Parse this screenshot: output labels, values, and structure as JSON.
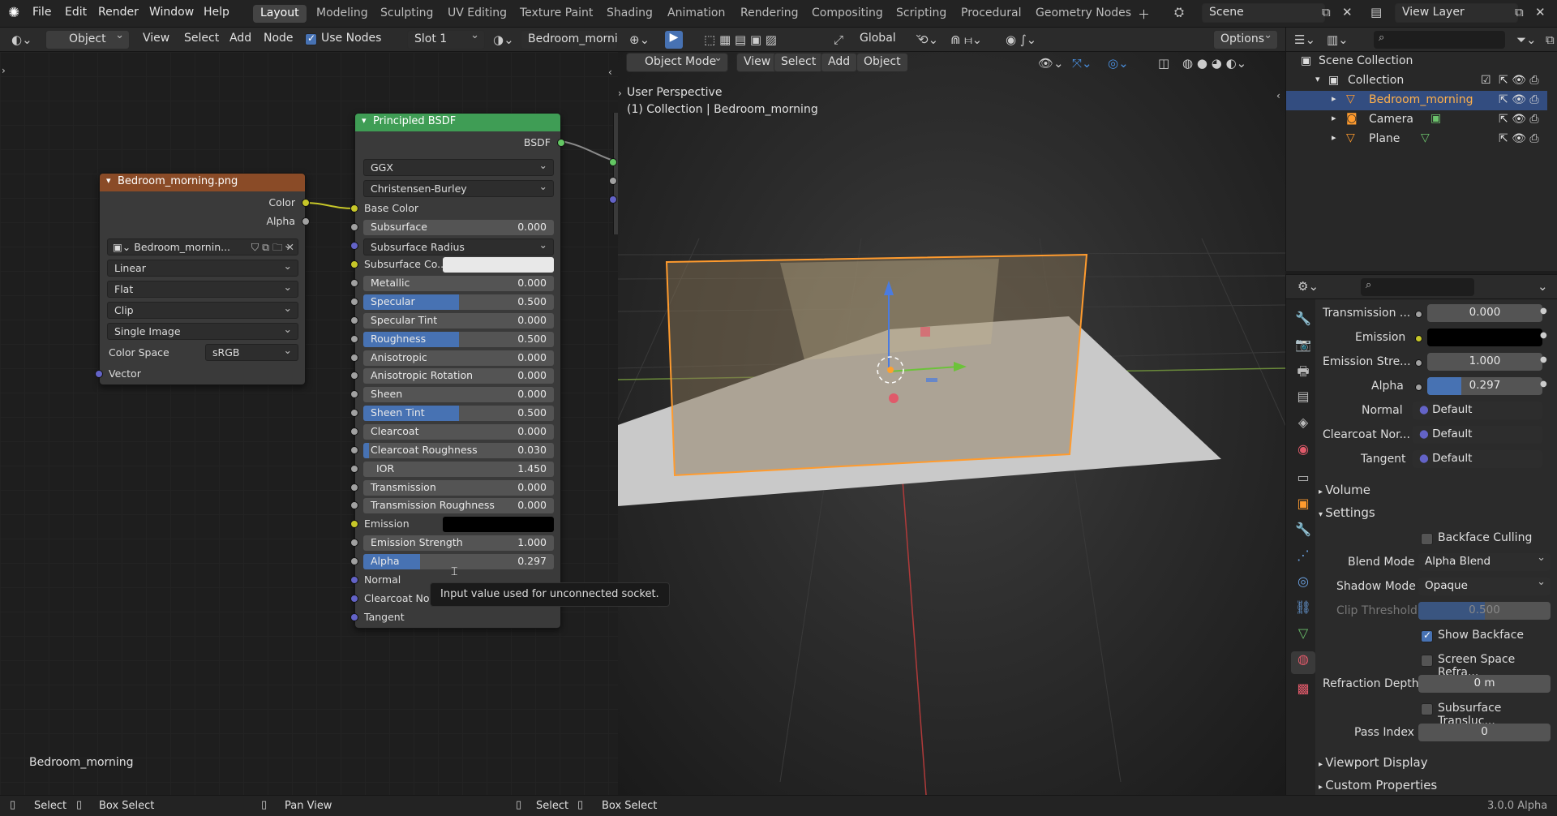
{
  "menu": {
    "file": "File",
    "edit": "Edit",
    "render": "Render",
    "window": "Window",
    "help": "Help"
  },
  "workspaces": [
    "Layout",
    "Modeling",
    "Sculpting",
    "UV Editing",
    "Texture Paint",
    "Shading",
    "Animation",
    "Rendering",
    "Compositing",
    "Scripting",
    "Procedural",
    "Geometry Nodes"
  ],
  "scene": {
    "name": "Scene",
    "view_layer": "View Layer"
  },
  "node_header": {
    "object": "Object",
    "view": "View",
    "select": "Select",
    "add": "Add",
    "node": "Node",
    "use_nodes": "Use Nodes",
    "slot": "Slot 1",
    "material": "Bedroom_mornin"
  },
  "image_node": {
    "title": "Bedroom_morning.png",
    "out_color": "Color",
    "out_alpha": "Alpha",
    "image_name": "Bedroom_mornin...",
    "interpolation": "Linear",
    "projection": "Flat",
    "extension": "Clip",
    "source": "Single Image",
    "color_space_label": "Color Space",
    "color_space": "sRGB",
    "vector": "Vector"
  },
  "bsdf": {
    "title": "Principled BSDF",
    "output": "BSDF",
    "distribution": "GGX",
    "subsurface_method": "Christensen-Burley",
    "base_color": "Base Color",
    "subsurface_radius": "Subsurface Radius",
    "subsurface_color": "Subsurface Co...",
    "emission": "Emission",
    "normal": "Normal",
    "clearcoat_normal": "Clearcoat Nor",
    "tangent": "Tangent",
    "fields": [
      {
        "label": "Subsurface",
        "value": "0.000",
        "fill": 0
      },
      {
        "label": "Metallic",
        "value": "0.000",
        "fill": 0
      },
      {
        "label": "Specular",
        "value": "0.500",
        "fill": 0.5
      },
      {
        "label": "Specular Tint",
        "value": "0.000",
        "fill": 0
      },
      {
        "label": "Roughness",
        "value": "0.500",
        "fill": 0.5
      },
      {
        "label": "Anisotropic",
        "value": "0.000",
        "fill": 0
      },
      {
        "label": "Anisotropic Rotation",
        "value": "0.000",
        "fill": 0
      },
      {
        "label": "Sheen",
        "value": "0.000",
        "fill": 0
      },
      {
        "label": "Sheen Tint",
        "value": "0.500",
        "fill": 0.5
      },
      {
        "label": "Clearcoat",
        "value": "0.000",
        "fill": 0
      },
      {
        "label": "Clearcoat Roughness",
        "value": "0.030",
        "fill": 0.03
      },
      {
        "label": "IOR",
        "value": "1.450",
        "fill": 0
      },
      {
        "label": "Transmission",
        "value": "0.000",
        "fill": 0
      },
      {
        "label": "Transmission Roughness",
        "value": "0.000",
        "fill": 0
      },
      {
        "label": "Emission Strength",
        "value": "1.000",
        "fill": 0
      },
      {
        "label": "Alpha",
        "value": "0.297",
        "fill": 0.297
      }
    ]
  },
  "tooltip": "Input value used for unconnected socket.",
  "node_footer": "Bedroom_morning",
  "viewport": {
    "mode": "Object Mode",
    "view": "View",
    "select": "Select",
    "add": "Add",
    "object": "Object",
    "orientation": "Global",
    "options": "Options",
    "perspective": "User Perspective",
    "collection": "(1) Collection | Bedroom_morning"
  },
  "outliner": {
    "scene_collection": "Scene Collection",
    "collection": "Collection",
    "items": [
      "Bedroom_morning",
      "Camera",
      "Plane"
    ]
  },
  "properties": {
    "transmission_label": "Transmission ...",
    "transmission": "0.000",
    "emission_label": "Emission",
    "emission_strength_label": "Emission Stre...",
    "emission_strength": "1.000",
    "alpha_label": "Alpha",
    "alpha": "0.297",
    "alpha_fill": 0.297,
    "normal_label": "Normal",
    "normal": "Default",
    "clearcoat_normal_label": "Clearcoat Nor...",
    "clearcoat_normal": "Default",
    "tangent_label": "Tangent",
    "tangent": "Default",
    "volume": "Volume",
    "settings": "Settings",
    "backface_culling": "Backface Culling",
    "blend_mode_label": "Blend Mode",
    "blend_mode": "Alpha Blend",
    "shadow_mode_label": "Shadow Mode",
    "shadow_mode": "Opaque",
    "clip_threshold_label": "Clip Threshold",
    "clip_threshold": "0.500",
    "show_backface": "Show Backface",
    "screen_space_refraction": "Screen Space Refra...",
    "refraction_depth_label": "Refraction Depth",
    "refraction_depth": "0 m",
    "subsurface_translucency": "Subsurface Transluc...",
    "pass_index_label": "Pass Index",
    "pass_index": "0",
    "viewport_display": "Viewport Display",
    "custom_properties": "Custom Properties"
  },
  "status": {
    "select": "Select",
    "box_select": "Box Select",
    "pan_view": "Pan View",
    "select2": "Select",
    "box_select2": "Box Select",
    "version": "3.0.0 Alpha"
  }
}
